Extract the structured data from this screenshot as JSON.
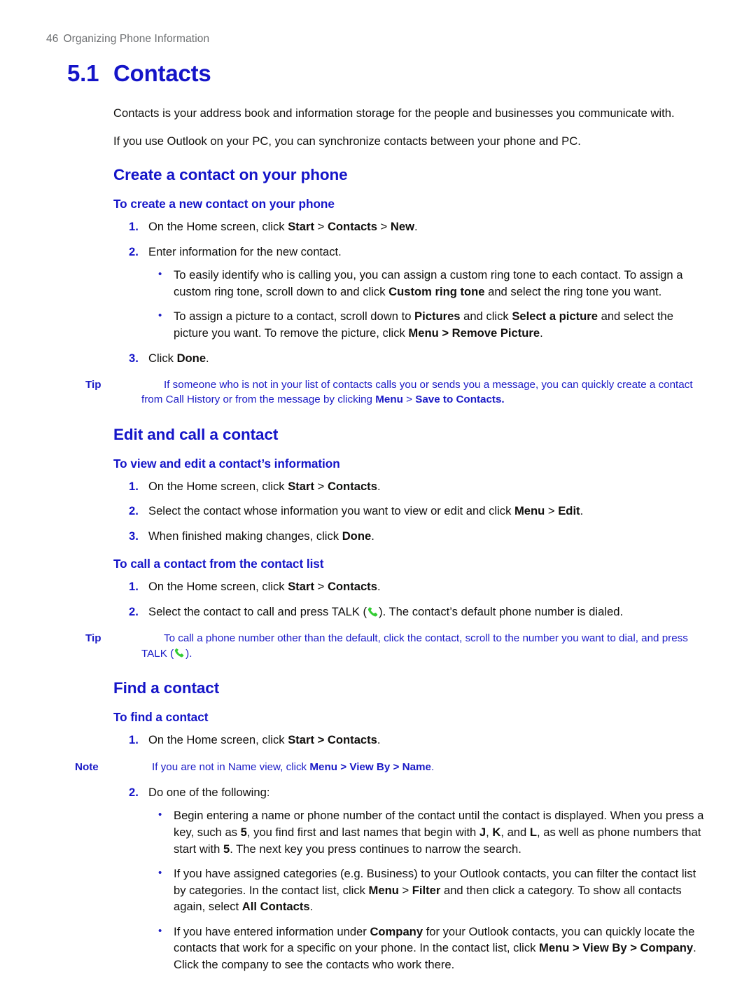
{
  "header": {
    "page_number": "46",
    "section_title": "Organizing Phone Information"
  },
  "chapter": {
    "number": "5.1",
    "title": "Contacts"
  },
  "intro": {
    "p1": "Contacts is your address book and information storage for the people and businesses you communicate with.",
    "p2": "If you use Outlook on your PC, you can synchronize contacts between your phone and PC."
  },
  "sections": {
    "create": {
      "heading": "Create a contact on your phone",
      "sub_heading": "To create a new contact on your phone",
      "step1_pre": "On the Home screen, click ",
      "step1_kw1": "Start",
      "step1_sep1": " > ",
      "step1_kw2": "Contacts",
      "step1_sep2": " > ",
      "step1_kw3": "New",
      "step1_end": ".",
      "step2": "Enter information for the new contact.",
      "bullet1_pre": "To easily identify who is calling you, you can assign a custom ring tone to each contact. To assign a custom ring tone, scroll down to and click ",
      "bullet1_kw": "Custom ring tone",
      "bullet1_post": " and select the ring tone you want.",
      "bullet2_pre": "To assign a picture to a contact, scroll down to ",
      "bullet2_kw1": "Pictures",
      "bullet2_mid": " and click ",
      "bullet2_kw2": "Select a picture",
      "bullet2_mid2": " and select the picture you want. To remove the picture, click ",
      "bullet2_kw3": "Menu > Remove Picture",
      "bullet2_end": ".",
      "step3_pre": "Click ",
      "step3_kw": "Done",
      "step3_end": ".",
      "tip_label": "Tip",
      "tip_pre": "If someone who is not in your list of contacts calls you or sends you a message, you can quickly create a contact from Call History or from the message by clicking ",
      "tip_kw1": "Menu",
      "tip_sep": " > ",
      "tip_kw2": "Save to Contacts."
    },
    "edit": {
      "heading": "Edit and call a contact",
      "sub_heading_view": "To view and edit a contact’s information",
      "view_step1_pre": "On the Home screen, click ",
      "view_step1_kw1": "Start",
      "view_step1_sep": " > ",
      "view_step1_kw2": "Contacts",
      "view_step1_end": ".",
      "view_step2_pre": "Select the contact whose information you want to view or edit and click ",
      "view_step2_kw1": "Menu",
      "view_step2_sep": " > ",
      "view_step2_kw2": "Edit",
      "view_step2_end": ".",
      "view_step3_pre": "When finished making changes, click ",
      "view_step3_kw": "Done",
      "view_step3_end": ".",
      "sub_heading_call": "To call a contact from the contact list",
      "call_step1_pre": "On the Home screen, click ",
      "call_step1_kw1": "Start",
      "call_step1_sep": " > ",
      "call_step1_kw2": "Contacts",
      "call_step1_end": ".",
      "call_step2_pre": "Select the contact to call and press TALK (",
      "call_step2_post": "). The contact’s default phone number is dialed.",
      "tip_label": "Tip",
      "tip_text_pre": "To call a phone number other than the default, click the contact, scroll to the number you want to dial, and press TALK (",
      "tip_text_post": ")."
    },
    "find": {
      "heading": "Find a contact",
      "sub_heading": "To find a contact",
      "step1_pre": "On the Home screen, click ",
      "step1_kw": "Start > Contacts",
      "step1_end": ".",
      "note_label": "Note",
      "note_pre": "If you are not in Name view, click ",
      "note_kw": "Menu > View By > Name",
      "note_end": ".",
      "step2": "Do one of the following:",
      "bullet1_pre": "Begin entering a name or phone number of the contact until the contact is displayed. When you press a key, such as ",
      "bullet1_kw1": "5",
      "bullet1_mid1": ", you find first and last names that begin with ",
      "bullet1_kw2": "J",
      "bullet1_mid2": ", ",
      "bullet1_kw3": "K",
      "bullet1_mid3": ", and ",
      "bullet1_kw4": "L",
      "bullet1_mid4": ", as well as phone numbers that start with ",
      "bullet1_kw5": "5",
      "bullet1_end": ". The next key you press continues to narrow the search.",
      "bullet2_pre": "If you have assigned categories (e.g. Business) to your Outlook contacts, you can filter the contact list by categories. In the contact list, click ",
      "bullet2_kw1": "Menu",
      "bullet2_sep": " > ",
      "bullet2_kw2": "Filter",
      "bullet2_mid": " and then click a category. To show all contacts again, select ",
      "bullet2_kw3": "All Contacts",
      "bullet2_end": ".",
      "bullet3_pre": "If you have entered information under ",
      "bullet3_kw1": "Company",
      "bullet3_mid1": " for your Outlook contacts, you can quickly locate the contacts that work for a specific on your phone. In the contact list, click ",
      "bullet3_kw2": "Menu > View By > Company",
      "bullet3_end": ". Click the company to see the contacts who work there."
    }
  },
  "icons": {
    "talk_phone": "green-phone-handset-icon"
  },
  "colors": {
    "heading_blue": "#1414c8",
    "callout_blue": "#1a1ac6",
    "header_gray": "#6d6f71",
    "body_black": "#100f0d",
    "phone_green": "#33cc33"
  }
}
